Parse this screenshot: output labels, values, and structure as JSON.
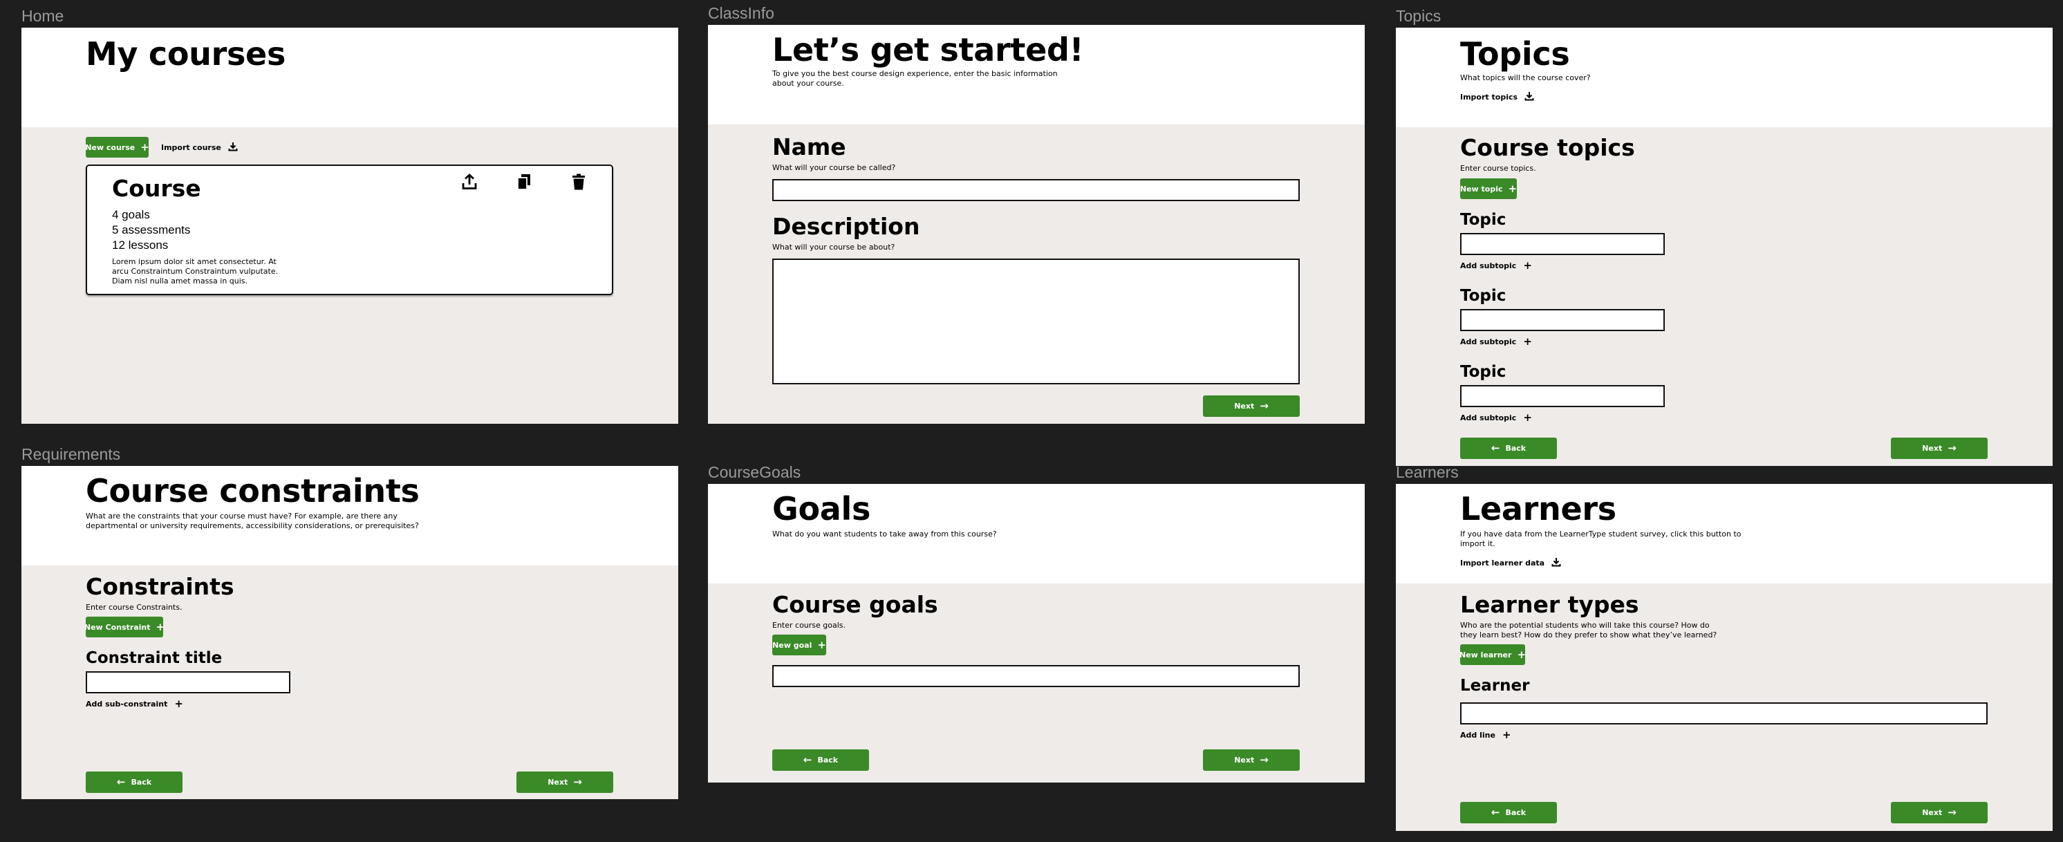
{
  "colors": {
    "canvas": "#1e1e1e",
    "frame_bg": "#efebe9",
    "header_bg": "#ffffff",
    "accent": "#3a8a28",
    "frame_label": "#9a9a9a"
  },
  "frames": {
    "home": {
      "label": "Home",
      "title": "My courses",
      "new_course": "New course",
      "import_course": "Import course",
      "card": {
        "title": "Course",
        "goals": "4 goals",
        "assessments": "5 assessments",
        "lessons": "12 lessons",
        "desc1": "Lorem ipsum dolor sit amet consectetur. At",
        "desc2": "arcu Constraintum Constraintum vulputate.",
        "desc3": "Diam nisl nulla amet massa in quis."
      }
    },
    "classinfo": {
      "label": "ClassInfo",
      "title": "Let’s get started!",
      "subtitle1": "To give you the best course design experience, enter the basic information",
      "subtitle2": "about your course.",
      "name_heading": "Name",
      "name_hint": "What will your course be called?",
      "desc_heading": "Description",
      "desc_hint": "What will your course be about?",
      "next": "Next"
    },
    "topics": {
      "label": "Topics",
      "title": "Topics",
      "subtitle": "What topics will the course cover?",
      "import_topics": "Import topics",
      "section_title": "Course topics",
      "section_hint": "Enter course topics.",
      "new_topic": "New topic",
      "topic_label": "Topic",
      "add_subtopic": "Add subtopic",
      "back": "Back",
      "next": "Next"
    },
    "requirements": {
      "label": "Requirements",
      "title": "Course constraints",
      "subtitle1": "What are the constraints that your course must have? For example, are there any",
      "subtitle2": "departmental or university requirements, accessibility considerations, or prerequisites?",
      "section_title": "Constraints",
      "section_hint": "Enter course Constraints.",
      "new_constraint": "New Constraint",
      "field_label": "Constraint title",
      "add_sub": "Add sub-constraint",
      "back": "Back",
      "next": "Next"
    },
    "coursegoals": {
      "label": "CourseGoals",
      "title": "Goals",
      "subtitle": "What do you want students to take away from this course?",
      "section_title": "Course goals",
      "section_hint": "Enter course goals.",
      "new_goal": "New goal",
      "back": "Back",
      "next": "Next"
    },
    "learners": {
      "label": "Learners",
      "title": "Learners",
      "subtitle1": "If you have data from the LearnerType student survey, click this button to",
      "subtitle2": "import it.",
      "import_data": "Import learner data",
      "section_title": "Learner types",
      "section_hint1": "Who are the potential students who will take this course? How do",
      "section_hint2": "they learn best? How do they prefer to show what they’ve learned?",
      "new_learner": "New learner",
      "field_label": "Learner",
      "add_line": "Add line",
      "back": "Back",
      "next": "Next"
    }
  }
}
